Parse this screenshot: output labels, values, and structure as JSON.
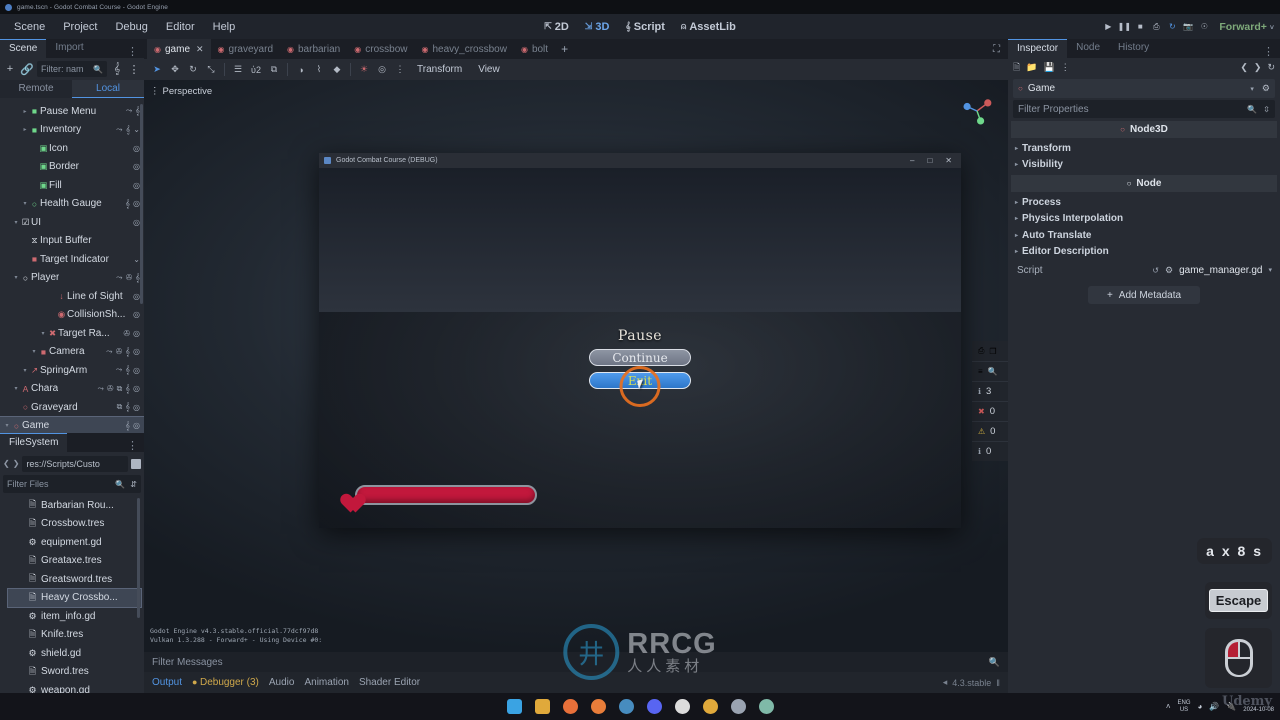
{
  "window": {
    "title": "game.tscn - Godot Combat Course - Godot Engine"
  },
  "menubar": {
    "items": [
      "Scene",
      "Project",
      "Debug",
      "Editor",
      "Help"
    ],
    "modes": [
      {
        "label": "2D",
        "icon": "2d-icon",
        "active": false
      },
      {
        "label": "3D",
        "icon": "3d-icon",
        "active": true
      },
      {
        "label": "Script",
        "icon": "script-icon",
        "active": false
      },
      {
        "label": "AssetLib",
        "icon": "assetlib-icon",
        "active": false
      }
    ],
    "play_buttons": [
      {
        "name": "play-button",
        "glyph": "▶",
        "active": false
      },
      {
        "name": "pause-button",
        "glyph": "❚❚",
        "active": false
      },
      {
        "name": "stop-button",
        "glyph": "■",
        "active": false
      },
      {
        "name": "play-scene-button",
        "glyph": "⎙",
        "active": false
      },
      {
        "name": "reload-button",
        "glyph": "↻",
        "active": true
      },
      {
        "name": "movie-maker-button",
        "glyph": "὏7",
        "active": false
      },
      {
        "name": "remote-debug-button",
        "glyph": "⁂",
        "active": false
      }
    ],
    "renderer": "Forward+",
    "renderer_caret": "˅"
  },
  "scene_dock": {
    "tabs": [
      {
        "label": "Scene",
        "active": true
      },
      {
        "label": "Import",
        "active": false
      }
    ],
    "toolbar": {
      "add_icon": "plus-icon",
      "link_icon": "instantiate-icon",
      "filter_placeholder": "Filter: nam",
      "search_icon": "search-icon",
      "script_icon": "script-icon",
      "menu_icon": "kebab-menu-icon"
    },
    "mode_tabs": [
      {
        "label": "Remote",
        "active": false
      },
      {
        "label": "Local",
        "active": true
      }
    ],
    "tree": [
      {
        "label": "Game",
        "indent": 0,
        "icon": "○",
        "color": "#cd6a70",
        "arrow": "▾",
        "selected": true,
        "badges": [
          "script",
          "visibility"
        ]
      },
      {
        "label": "Graveyard",
        "indent": 1,
        "icon": "○",
        "color": "#cd6a70",
        "arrow": "",
        "selected": false,
        "badges": [
          "instance",
          "script",
          "visibility"
        ]
      },
      {
        "label": "Chara",
        "indent": 1,
        "icon": "A",
        "color": "#cd6a70",
        "arrow": "▾",
        "selected": false,
        "badges": [
          "signal",
          "group",
          "instance",
          "script",
          "visibility"
        ]
      },
      {
        "label": "SpringArm",
        "indent": 2,
        "icon": "↗",
        "color": "#cd6a70",
        "arrow": "▾",
        "selected": false,
        "badges": [
          "signal",
          "script",
          "visibility"
        ]
      },
      {
        "label": "Camera",
        "indent": 3,
        "icon": "■",
        "color": "#cd6a70",
        "arrow": "▾",
        "selected": false,
        "badges": [
          "signal",
          "group",
          "script",
          "visibility"
        ]
      },
      {
        "label": "Target Ra...",
        "indent": 4,
        "icon": "✖",
        "color": "#cd6a70",
        "arrow": "▾",
        "selected": false,
        "badges": [
          "group",
          "visibility"
        ]
      },
      {
        "label": "CollisionSh...",
        "indent": 5,
        "icon": "◉",
        "color": "#cd6a70",
        "arrow": "",
        "selected": false,
        "badges": [
          "visibility"
        ]
      },
      {
        "label": "Line of Sight",
        "indent": 5,
        "icon": "↓",
        "color": "#cd6a70",
        "arrow": "",
        "selected": false,
        "badges": [
          "visibility"
        ]
      },
      {
        "label": "Player",
        "indent": 1,
        "icon": "○",
        "color": "#dfe4eb",
        "arrow": "▾",
        "selected": false,
        "badges": [
          "signal",
          "group",
          "script"
        ]
      },
      {
        "label": "Target Indicator",
        "indent": 2,
        "icon": "■",
        "color": "#cd6a70",
        "arrow": "",
        "selected": false,
        "badges": [
          "chevron"
        ]
      },
      {
        "label": "Input Buffer",
        "indent": 2,
        "icon": "⧖",
        "color": "#dfe4eb",
        "arrow": "",
        "selected": false,
        "badges": []
      },
      {
        "label": "UI",
        "indent": 1,
        "icon": "☑",
        "color": "#dfe4eb",
        "arrow": "▾",
        "selected": false,
        "badges": [
          "visibility"
        ]
      },
      {
        "label": "Health Gauge",
        "indent": 2,
        "icon": "○",
        "color": "#6fd88b",
        "arrow": "▾",
        "selected": false,
        "badges": [
          "script",
          "visibility"
        ]
      },
      {
        "label": "Fill",
        "indent": 3,
        "icon": "▣",
        "color": "#6fd88b",
        "arrow": "",
        "selected": false,
        "badges": [
          "visibility"
        ]
      },
      {
        "label": "Border",
        "indent": 3,
        "icon": "▣",
        "color": "#6fd88b",
        "arrow": "",
        "selected": false,
        "badges": [
          "visibility"
        ]
      },
      {
        "label": "Icon",
        "indent": 3,
        "icon": "▣",
        "color": "#6fd88b",
        "arrow": "",
        "selected": false,
        "badges": [
          "visibility"
        ]
      },
      {
        "label": "Inventory",
        "indent": 2,
        "icon": "■",
        "color": "#6fd88b",
        "arrow": "▸",
        "selected": false,
        "badges": [
          "signal",
          "script",
          "chevron"
        ]
      },
      {
        "label": "Pause Menu",
        "indent": 2,
        "icon": "■",
        "color": "#6fd88b",
        "arrow": "▸",
        "selected": false,
        "badges": [
          "signal",
          "script"
        ]
      }
    ]
  },
  "filesystem": {
    "title": "FileSystem",
    "path": "res://Scripts/Custo",
    "filter_placeholder": "Filter Files",
    "files": [
      {
        "name": "Barbarian Rou...",
        "icon": "resource",
        "selected": false
      },
      {
        "name": "Crossbow.tres",
        "icon": "resource",
        "selected": false
      },
      {
        "name": "equipment.gd",
        "icon": "script",
        "selected": false
      },
      {
        "name": "Greataxe.tres",
        "icon": "resource",
        "selected": false
      },
      {
        "name": "Greatsword.tres",
        "icon": "resource",
        "selected": false
      },
      {
        "name": "Heavy Crossbo...",
        "icon": "resource",
        "selected": true
      },
      {
        "name": "item_info.gd",
        "icon": "script",
        "selected": false
      },
      {
        "name": "Knife.tres",
        "icon": "resource",
        "selected": false
      },
      {
        "name": "shield.gd",
        "icon": "script",
        "selected": false
      },
      {
        "name": "Sword.tres",
        "icon": "resource",
        "selected": false
      },
      {
        "name": "weapon.gd",
        "icon": "script",
        "selected": false
      }
    ]
  },
  "editor": {
    "tabs": [
      {
        "label": "game",
        "active": true,
        "closable": true
      },
      {
        "label": "graveyard",
        "active": false,
        "closable": false
      },
      {
        "label": "barbarian",
        "active": false,
        "closable": false
      },
      {
        "label": "crossbow",
        "active": false,
        "closable": false
      },
      {
        "label": "heavy_crossbow",
        "active": false,
        "closable": false
      },
      {
        "label": "bolt",
        "active": false,
        "closable": false
      }
    ],
    "add_tab": "+",
    "toolbar": {
      "tools": [
        {
          "name": "select-mode-icon",
          "glyph": "➤",
          "active": true
        },
        {
          "name": "move-mode-icon",
          "glyph": "✥",
          "active": false
        },
        {
          "name": "rotate-mode-icon",
          "glyph": "↻",
          "active": false
        },
        {
          "name": "scale-mode-icon",
          "glyph": "⤡",
          "active": false
        },
        {
          "name": "list-select-icon",
          "glyph": "☰",
          "active": false
        },
        {
          "name": "lock-icon",
          "glyph": "ὑ2",
          "active": false
        },
        {
          "name": "group-icon",
          "glyph": "⧉",
          "active": false
        },
        {
          "name": "local-space-icon",
          "glyph": "◑",
          "active": false
        },
        {
          "name": "snap-icon",
          "glyph": "⌇",
          "active": false
        },
        {
          "name": "camera-preview-icon",
          "glyph": "◆",
          "active": false
        },
        {
          "name": "sun-icon",
          "glyph": "☀",
          "active": false
        },
        {
          "name": "environment-icon",
          "glyph": "◎",
          "active": false
        },
        {
          "name": "view-menu-icon",
          "glyph": "⋮",
          "active": false
        }
      ],
      "menus": [
        "Transform",
        "View"
      ]
    },
    "viewport": {
      "perspective_label": "Perspective",
      "info_line1": "Godot Engine v4.3.stable.official.77dcf97d8",
      "info_line2": "Vulkan 1.3.288 - Forward+ - Using Device #0:"
    },
    "debug_counters": [
      {
        "name": "info-count",
        "glyph": "ℹ",
        "color": "#9aa3b1",
        "value": "3"
      },
      {
        "name": "error-count",
        "glyph": "✖",
        "color": "#cd5a5a",
        "value": "0"
      },
      {
        "name": "warning-count",
        "glyph": "⚠",
        "color": "#d8b542",
        "value": "0"
      },
      {
        "name": "misc-count",
        "glyph": "ℹ",
        "color": "#9aa3b1",
        "value": "0"
      }
    ],
    "bottom": {
      "filter_placeholder": "Filter Messages",
      "tabs": [
        {
          "label": "Output",
          "active": true,
          "kind": "normal"
        },
        {
          "label": "Debugger (3)",
          "active": false,
          "kind": "debugger"
        },
        {
          "label": "Audio",
          "active": false,
          "kind": "normal"
        },
        {
          "label": "Animation",
          "active": false,
          "kind": "normal"
        },
        {
          "label": "Shader Editor",
          "active": false,
          "kind": "normal"
        }
      ],
      "version": "4.3.stable"
    }
  },
  "inspector": {
    "tabs": [
      {
        "label": "Inspector",
        "active": true
      },
      {
        "label": "Node",
        "active": false
      },
      {
        "label": "History",
        "active": false
      }
    ],
    "node_name": "Game",
    "filter_placeholder": "Filter Properties",
    "sections": [
      {
        "header": "Node3D",
        "header_icon_color": "#cd6a70",
        "properties": [
          "Transform",
          "Visibility"
        ]
      },
      {
        "header": "Node",
        "header_icon_color": "#dfe4eb",
        "properties": [
          "Process",
          "Physics Interpolation",
          "Auto Translate",
          "Editor Description"
        ]
      }
    ],
    "script": {
      "label": "Script",
      "value": "game_manager.gd"
    },
    "add_metadata": "Add Metadata"
  },
  "game_window": {
    "title": "Godot Combat Course (DEBUG)",
    "controls": [
      "–",
      "□",
      "✕"
    ],
    "pause_menu": {
      "title": "Pause",
      "buttons": [
        {
          "label": "Continue",
          "style": "grey",
          "focused": false
        },
        {
          "label": "Exit",
          "style": "blue",
          "focused": true
        }
      ]
    },
    "hud": {
      "health_icon": "heart-icon",
      "health_percent": 100
    }
  },
  "key_overlay": {
    "combo": "a x 8 s",
    "key": "Escape",
    "mouse": "left-button-pressed"
  },
  "watermark": {
    "latin": "RRCG",
    "chinese": "人人素材"
  },
  "taskbar": {
    "apps": [
      {
        "name": "start-icon",
        "color": "#3aa3e3"
      },
      {
        "name": "files-icon",
        "color": "#e0a93b"
      },
      {
        "name": "firefox-icon",
        "color": "#e8703a"
      },
      {
        "name": "blender-icon",
        "color": "#e87d3a"
      },
      {
        "name": "godot-icon",
        "color": "#478cbf"
      },
      {
        "name": "discord-icon",
        "color": "#5865f2"
      },
      {
        "name": "app7-icon",
        "color": "#dcdcdc"
      },
      {
        "name": "app8-icon",
        "color": "#e0a93b"
      },
      {
        "name": "app9-icon",
        "color": "#9aa3b1"
      },
      {
        "name": "notes-icon",
        "color": "#7fb9a8"
      }
    ],
    "tray": {
      "chevron": "˄",
      "language": "ENG",
      "region": "US",
      "icons": [
        "wifi-icon",
        "volume-icon",
        "battery-icon"
      ],
      "date": "2024-10-08",
      "brand": "Udemy"
    }
  }
}
